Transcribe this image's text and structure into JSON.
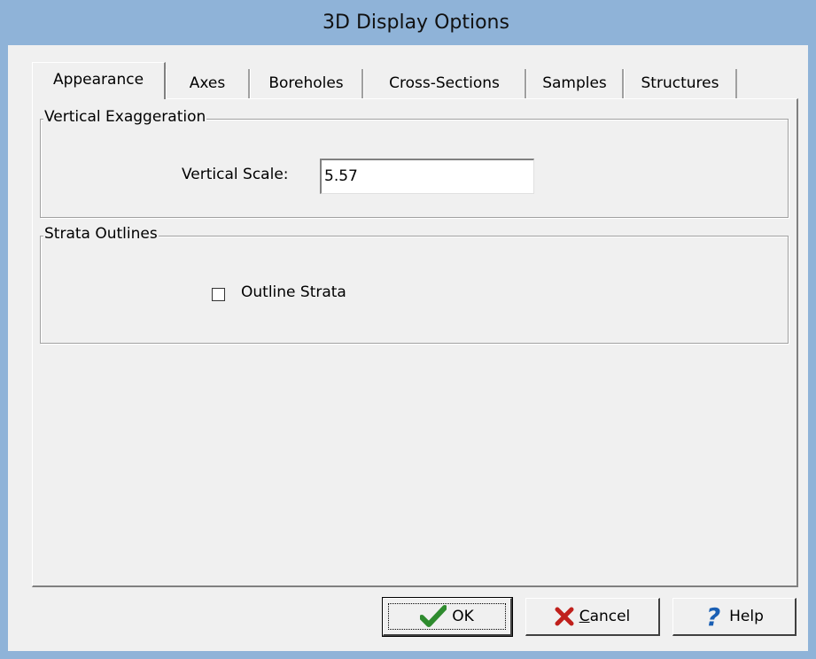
{
  "window": {
    "title": "3D Display Options"
  },
  "tabs": [
    {
      "label": "Appearance",
      "active": true
    },
    {
      "label": "Axes",
      "active": false
    },
    {
      "label": "Boreholes",
      "active": false
    },
    {
      "label": "Cross-Sections",
      "active": false
    },
    {
      "label": "Samples",
      "active": false
    },
    {
      "label": "Structures",
      "active": false
    }
  ],
  "vertical_exaggeration": {
    "group_label": "Vertical Exaggeration",
    "scale_label": "Vertical Scale:",
    "scale_value": "5.57"
  },
  "strata_outlines": {
    "group_label": "Strata Outlines",
    "outline_label": "Outline Strata",
    "outline_checked": false
  },
  "buttons": {
    "ok_label": "OK",
    "cancel_label": "ancel",
    "cancel_mnemonic": "C",
    "help_label": "Help"
  },
  "colors": {
    "titlebar": "#8fb3d8",
    "ok_check": "#2e8b2e",
    "cancel_x": "#c0201c",
    "help_q": "#1a5fb4"
  }
}
